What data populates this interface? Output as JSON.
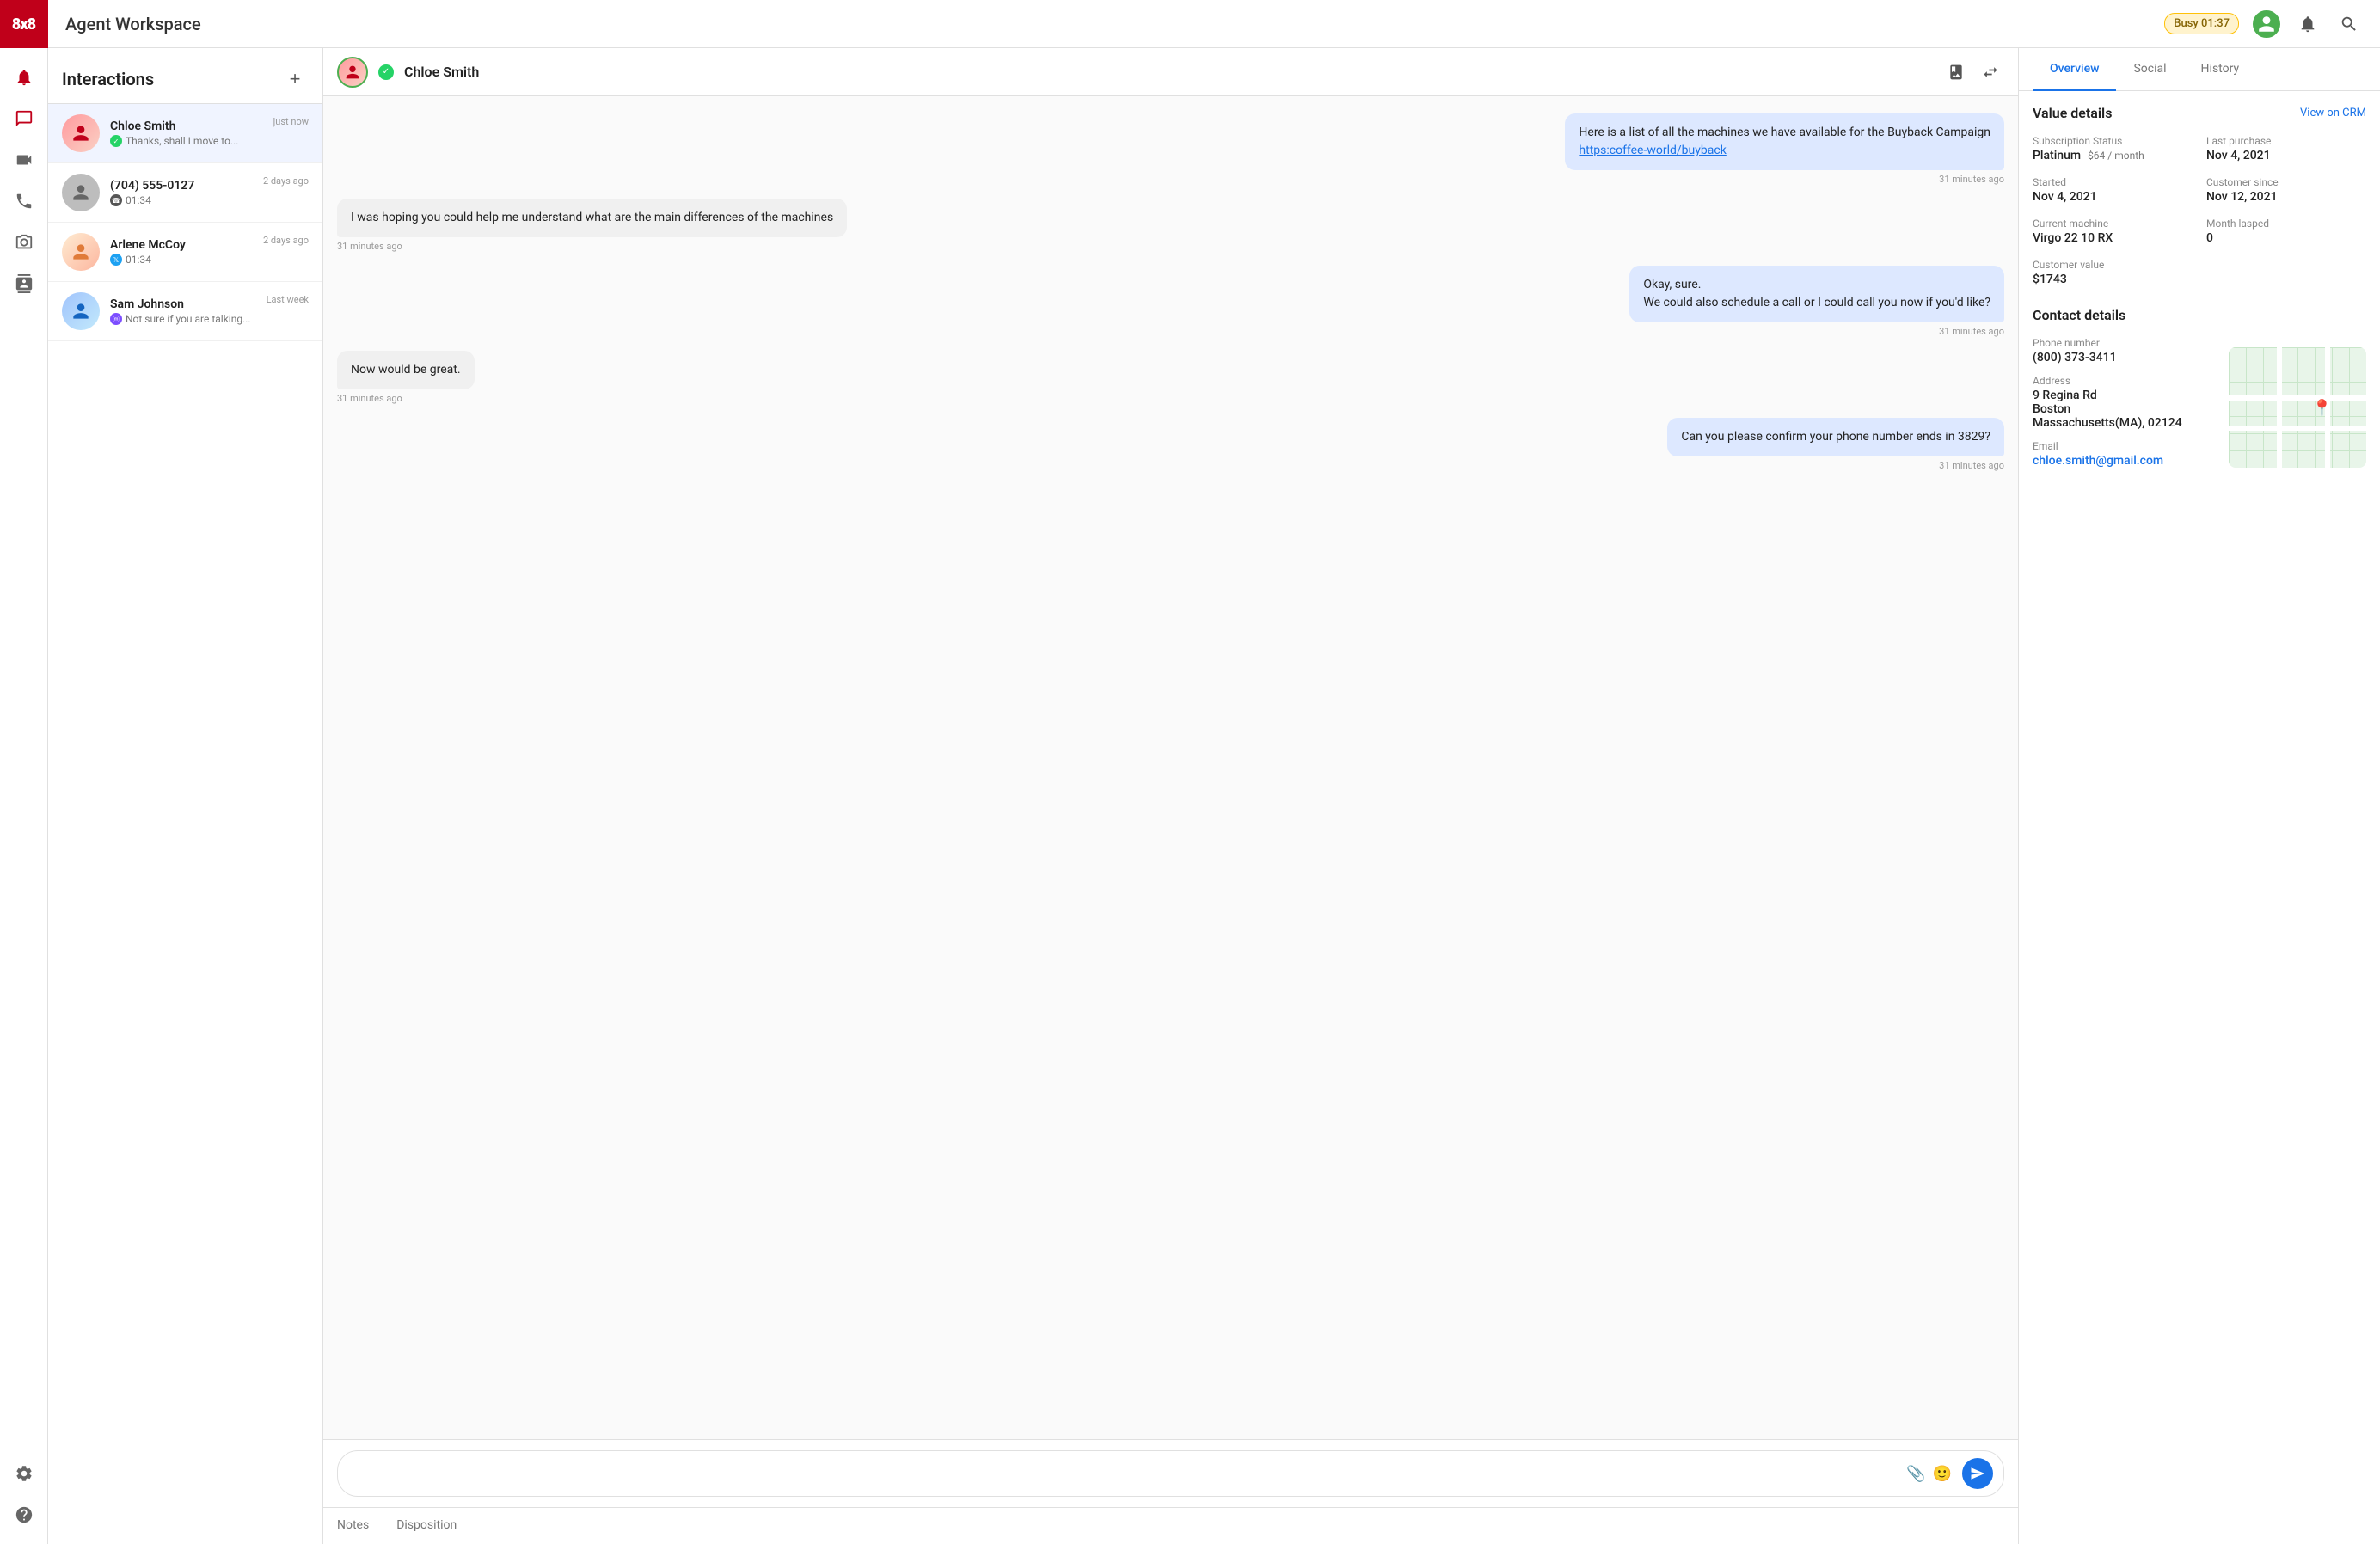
{
  "app": {
    "logo": "8x8",
    "title": "Agent Workspace",
    "status": "Busy 01:37"
  },
  "nav": {
    "items": [
      {
        "id": "phone",
        "icon": "phone",
        "active": false
      },
      {
        "id": "chat",
        "icon": "chat",
        "active": true
      },
      {
        "id": "video",
        "icon": "video",
        "active": false
      },
      {
        "id": "call",
        "icon": "call",
        "active": false
      },
      {
        "id": "camera",
        "icon": "camera",
        "active": false
      },
      {
        "id": "contacts",
        "icon": "contacts",
        "active": false
      }
    ],
    "bottom": [
      {
        "id": "settings",
        "icon": "settings"
      },
      {
        "id": "help",
        "icon": "help"
      }
    ]
  },
  "interactions": {
    "title": "Interactions",
    "add_label": "+",
    "items": [
      {
        "id": 1,
        "name": "Chloe Smith",
        "time": "just now",
        "preview": "Thanks, shall I move to...",
        "channel": "whatsapp",
        "active": true,
        "avatar_color": "av-chloe"
      },
      {
        "id": 2,
        "name": "(704) 555-0127",
        "time": "2 days ago",
        "preview": "01:34",
        "channel": "phone",
        "active": false,
        "avatar_color": "av-phone"
      },
      {
        "id": 3,
        "name": "Arlene McCoy",
        "time": "2 days ago",
        "preview": "01:34",
        "channel": "twitter",
        "active": false,
        "avatar_color": "av-arlene"
      },
      {
        "id": 4,
        "name": "Sam Johnson",
        "time": "Last week",
        "preview": "Not sure if you are talking...",
        "channel": "messenger",
        "active": false,
        "avatar_color": "av-sam"
      }
    ]
  },
  "chat": {
    "contact_name": "Chloe Smith",
    "messages": [
      {
        "id": 1,
        "type": "agent",
        "text": "Here is a list of all the machines we have available for the Buyback Campaign",
        "link": "https:coffee-world/buyback",
        "time": "31 minutes ago"
      },
      {
        "id": 2,
        "type": "customer",
        "text": "I was hoping you could help me understand what are the main differences of the machines",
        "time": "31 minutes ago"
      },
      {
        "id": 3,
        "type": "agent",
        "text": "Okay, sure.\nWe could also schedule a call or I could call you now if you'd like?",
        "time": "31 minutes ago"
      },
      {
        "id": 4,
        "type": "customer",
        "text": "Now would be great.",
        "time": "31 minutes ago"
      },
      {
        "id": 5,
        "type": "agent",
        "text": "Can you please confirm your phone number ends in 3829?",
        "time": "31 minutes ago"
      }
    ],
    "input_placeholder": "",
    "tabs": [
      {
        "id": "notes",
        "label": "Notes",
        "active": false
      },
      {
        "id": "disposition",
        "label": "Disposition",
        "active": false
      }
    ]
  },
  "details": {
    "tabs": [
      {
        "id": "overview",
        "label": "Overview",
        "active": true
      },
      {
        "id": "social",
        "label": "Social",
        "active": false
      },
      {
        "id": "history",
        "label": "History",
        "active": false
      }
    ],
    "value_details": {
      "title": "Value details",
      "view_crm": "View on CRM",
      "subscription_status_label": "Subscription Status",
      "subscription_status_value": "Platinum",
      "subscription_price": "$64 / month",
      "last_purchase_label": "Last purchase",
      "last_purchase_value": "Nov 4, 2021",
      "started_label": "Started",
      "started_value": "Nov 4, 2021",
      "customer_since_label": "Customer since",
      "customer_since_value": "Nov 12, 2021",
      "current_machine_label": "Current machine",
      "current_machine_value": "Virgo 22 10 RX",
      "month_lapsed_label": "Month lasped",
      "month_lapsed_value": "0",
      "customer_value_label": "Customer value",
      "customer_value_value": "$1743"
    },
    "contact_details": {
      "title": "Contact details",
      "phone_label": "Phone number",
      "phone_value": "(800) 373-3411",
      "address_label": "Address",
      "address_line1": "9 Regina Rd",
      "address_line2": "Boston",
      "address_line3": "Massachusetts(MA), 02124",
      "email_label": "Email",
      "email_value": "chloe.smith@gmail.com"
    }
  }
}
